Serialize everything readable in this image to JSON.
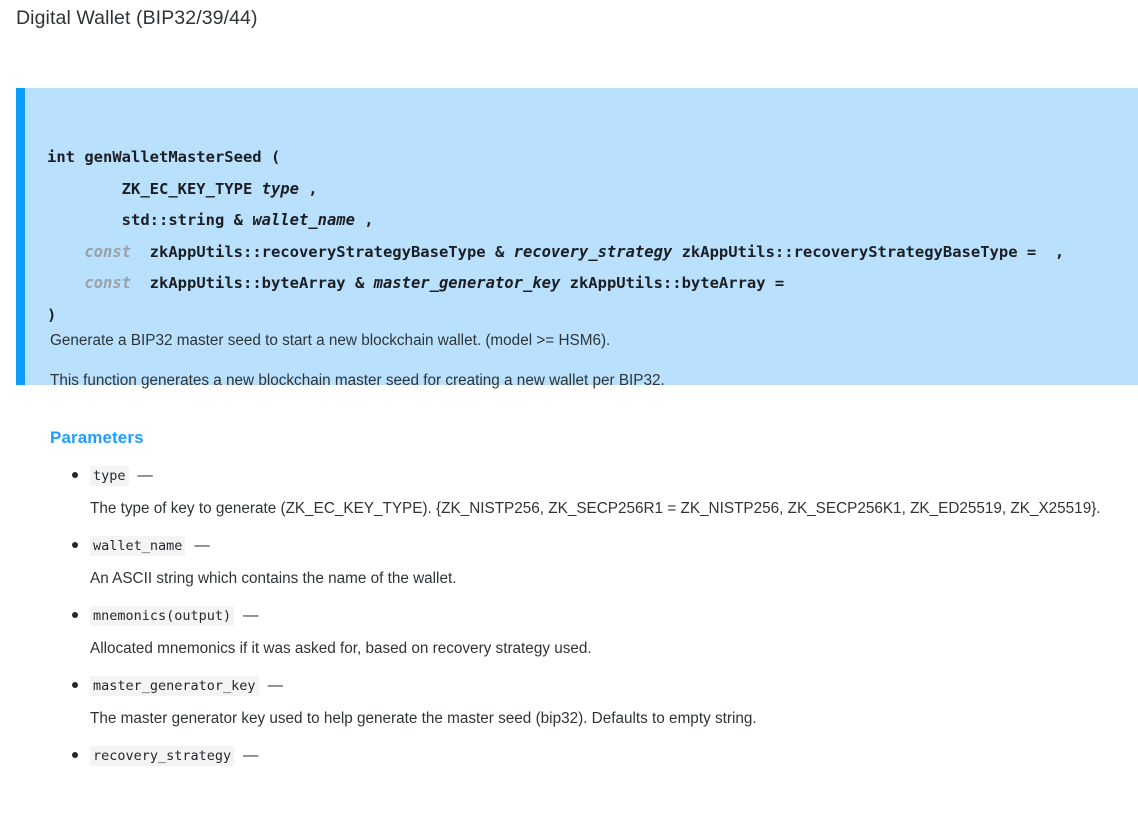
{
  "page": {
    "title": "Digital Wallet (BIP32/39/44)"
  },
  "signature": {
    "lines": [
      {
        "id": "line-1",
        "segments": [
          {
            "text": "int genWalletMasterSeed (",
            "style": "plain"
          }
        ]
      },
      {
        "id": "line-2",
        "segments": [
          {
            "text": "        ZK_EC_KEY_TYPE ",
            "style": "plain"
          },
          {
            "text": "type",
            "style": "italic"
          },
          {
            "text": " ,",
            "style": "plain"
          }
        ]
      },
      {
        "id": "line-3",
        "segments": [
          {
            "text": "        std::string & ",
            "style": "plain"
          },
          {
            "text": "wallet_name",
            "style": "italic"
          },
          {
            "text": " ,",
            "style": "plain"
          }
        ]
      },
      {
        "id": "line-4",
        "segments": [
          {
            "text": "    ",
            "style": "plain"
          },
          {
            "text": "const",
            "style": "keyword"
          },
          {
            "text": "  zkAppUtils::recoveryStrategyBaseType & ",
            "style": "plain"
          },
          {
            "text": "recovery_strategy",
            "style": "italic"
          },
          {
            "text": " zkAppUtils::recoveryStrategyBaseType =  ,",
            "style": "plain"
          }
        ]
      },
      {
        "id": "line-5",
        "segments": [
          {
            "text": "    ",
            "style": "plain"
          },
          {
            "text": "const",
            "style": "keyword"
          },
          {
            "text": "  zkAppUtils::byteArray & ",
            "style": "plain"
          },
          {
            "text": "master_generator_key",
            "style": "italic"
          },
          {
            "text": " zkAppUtils::byteArray =",
            "style": "plain"
          }
        ]
      },
      {
        "id": "line-6",
        "segments": [
          {
            "text": ")",
            "style": "plain"
          }
        ]
      }
    ]
  },
  "description": {
    "paragraphs": [
      "Generate a BIP32 master seed to start a new blockchain wallet. (model >= HSM6).",
      "This function generates a new blockchain master seed for creating a new wallet per BIP32."
    ]
  },
  "parameters_section": {
    "heading": "Parameters",
    "dash": "—",
    "items": [
      {
        "name": "type",
        "description": "The type of key to generate (ZK_EC_KEY_TYPE). {ZK_NISTP256, ZK_SECP256R1 = ZK_NISTP256, ZK_SECP256K1, ZK_ED25519, ZK_X25519}."
      },
      {
        "name": "wallet_name",
        "description": "An ASCII string which contains the name of the wallet."
      },
      {
        "name": "mnemonics(output)",
        "description": "Allocated mnemonics if it was asked for, based on recovery strategy used."
      },
      {
        "name": "master_generator_key",
        "description": "The master generator key used to help generate the master seed (bip32). Defaults to empty string."
      },
      {
        "name": "recovery_strategy",
        "description": ""
      }
    ]
  },
  "colors": {
    "code_background": "#b9e0fd",
    "code_accent_border": "#0d9cfd",
    "heading_blue": "#1e9eff",
    "body_text": "#2f3437",
    "inline_code_background": "#f4f4f4",
    "keyword_muted": "#9aa2a8"
  }
}
